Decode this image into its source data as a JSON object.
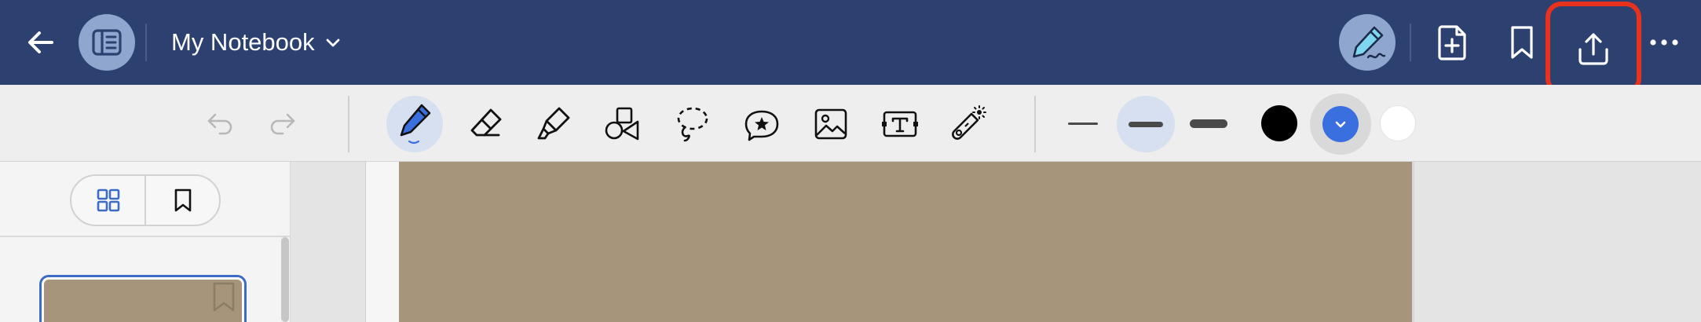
{
  "header": {
    "title": "My Notebook",
    "background_color": "#2d4170",
    "icons": {
      "back": "arrow-left-icon",
      "sidebar_toggle": "sidebar-panel-icon",
      "title_dropdown": "chevron-down-icon",
      "pen_mode": "pen-write-icon",
      "add_page": "file-plus-icon",
      "bookmark": "bookmark-icon",
      "share": "share-upload-icon",
      "more": "more-horizontal-icon"
    },
    "highlight_color": "#e8321e"
  },
  "toolbar": {
    "history": [
      {
        "name": "undo",
        "icon": "undo-icon",
        "enabled": false
      },
      {
        "name": "redo",
        "icon": "redo-icon",
        "enabled": false
      }
    ],
    "tools": [
      {
        "name": "pen",
        "icon": "pen-icon",
        "selected": true
      },
      {
        "name": "eraser",
        "icon": "eraser-icon",
        "selected": false
      },
      {
        "name": "highlighter",
        "icon": "highlighter-icon",
        "selected": false
      },
      {
        "name": "shapes",
        "icon": "shapes-icon",
        "selected": false
      },
      {
        "name": "lasso",
        "icon": "lasso-icon",
        "selected": false
      },
      {
        "name": "sticker",
        "icon": "sticker-icon",
        "selected": false
      },
      {
        "name": "image",
        "icon": "image-icon",
        "selected": false
      },
      {
        "name": "text",
        "icon": "text-box-icon",
        "selected": false
      },
      {
        "name": "laser-pointer",
        "icon": "laser-pointer-icon",
        "selected": false
      }
    ],
    "stroke_widths": [
      {
        "name": "thin",
        "selected": false
      },
      {
        "name": "medium",
        "selected": true
      },
      {
        "name": "thick",
        "selected": false
      }
    ],
    "colors": [
      {
        "name": "black",
        "hex": "#000000",
        "selected": false
      },
      {
        "name": "blue",
        "hex": "#3a6fe0",
        "selected": true
      },
      {
        "name": "white",
        "hex": "#ffffff",
        "selected": false
      }
    ],
    "accent_color": "#3d6cc4"
  },
  "sidebar": {
    "view_tabs": [
      {
        "name": "grid",
        "icon": "grid-icon",
        "selected": true
      },
      {
        "name": "bookmarks",
        "icon": "bookmark-icon",
        "selected": false
      }
    ],
    "pages": [
      {
        "selected": true,
        "color": "#a6957a"
      }
    ]
  },
  "canvas": {
    "page_color": "#a6957a"
  }
}
